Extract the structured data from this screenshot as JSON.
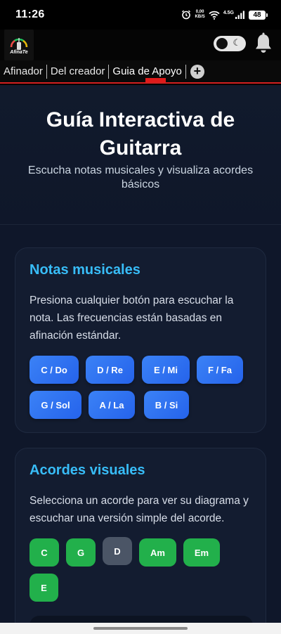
{
  "status_bar": {
    "time": "11:26",
    "net_speed_value": "0,00",
    "net_speed_unit": "KB/S",
    "signal_label": "4.5G",
    "battery": "48"
  },
  "app_bar": {
    "logo_text": "AfinaTe"
  },
  "tabs": [
    {
      "label": "Afinador"
    },
    {
      "label": "Del creador"
    },
    {
      "label": "Guia de Apoyo"
    }
  ],
  "tab_add_label": "+",
  "hero": {
    "title": "Guía Interactiva de Guitarra",
    "subtitle": "Escucha notas musicales y visualiza acordes básicos"
  },
  "notes_section": {
    "title": "Notas musicales",
    "description": "Presiona cualquier botón para escuchar la nota. Las frecuencias están basadas en afinación estándar.",
    "buttons": [
      "C / Do",
      "D / Re",
      "E / Mi",
      "F / Fa",
      "G / Sol",
      "A / La",
      "B / Si"
    ]
  },
  "chords_section": {
    "title": "Acordes visuales",
    "description": "Selecciona un acorde para ver su diagrama y escuchar una versión simple del acorde.",
    "buttons": [
      "C",
      "G",
      "D",
      "Am",
      "Em",
      "E"
    ],
    "selected": "D"
  },
  "colors": {
    "accent": "#38bdf8",
    "note_button": "#3b82f6",
    "chord_button": "#22b04b",
    "chord_selected": "#4b5566",
    "tab_indicator": "#e01b1b",
    "background": "#0f172a"
  }
}
